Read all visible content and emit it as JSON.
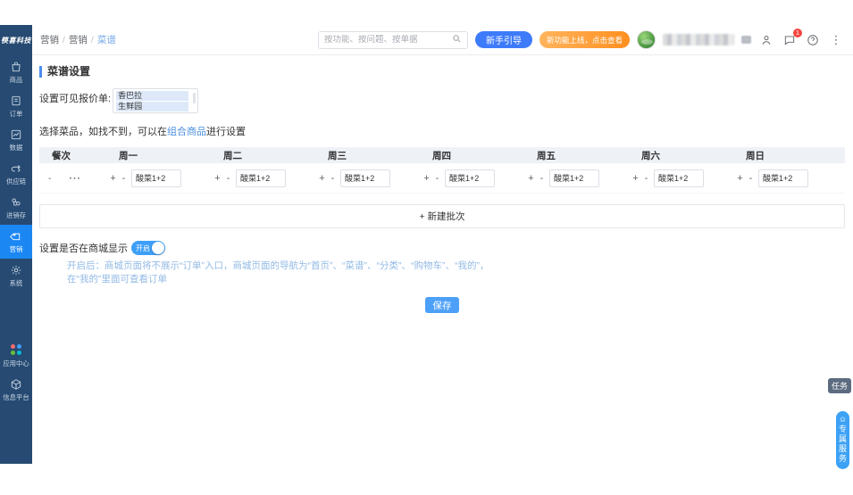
{
  "brand": {
    "name": "筷喜科技"
  },
  "sidebar": {
    "items": [
      {
        "label": "商品",
        "icon": "bag-icon"
      },
      {
        "label": "订单",
        "icon": "order-icon"
      },
      {
        "label": "数据",
        "icon": "chart-icon"
      },
      {
        "label": "供应链",
        "icon": "supply-chain-icon"
      },
      {
        "label": "进销存",
        "icon": "inventory-icon"
      },
      {
        "label": "营销",
        "icon": "marketing-tag-icon",
        "active": true
      },
      {
        "label": "系统",
        "icon": "gear-icon"
      },
      {
        "label": "应用中心",
        "icon": "app-center-icon"
      },
      {
        "label": "信息平台",
        "icon": "platform-cube-icon"
      }
    ]
  },
  "header": {
    "breadcrumb": [
      "营销",
      "营销",
      "菜谱"
    ],
    "separator": "/",
    "search_placeholder": "按功能、按问题、按单据",
    "guide_button": "新手引导",
    "promo_button": "新功能上线，点击查看",
    "chat_badge": "1",
    "more_glyph": "⋮"
  },
  "page": {
    "title": "菜谱设置",
    "quote_label": "设置可见报价单:",
    "quote_options": [
      "香巴拉",
      "生鲜园"
    ],
    "tip_prefix": "选择菜品，如找不到，可以在",
    "tip_link": "组合商品",
    "tip_suffix": "进行设置"
  },
  "schedule": {
    "columns": [
      "餐次",
      "周一",
      "周二",
      "周三",
      "周四",
      "周五",
      "周六",
      "周日"
    ],
    "row": {
      "mealtime": "-",
      "more": "···",
      "plus": "+",
      "minus": "-",
      "dish_value": "酸菜1+2"
    }
  },
  "actions": {
    "new_batch": "+ 新建批次",
    "save": "保存"
  },
  "mall": {
    "label": "设置是否在商城显示",
    "toggle_text": "开启",
    "hint_line1": "开启后：商城页面将不展示“订单”入口，商城页面的导航为“首页”、“菜谱”、“分类”、“购物车”、“我的”，",
    "hint_line2": "在“我的”里面可查看订单"
  },
  "floating": {
    "task": "任务",
    "service": "专属服务",
    "service_icon_glyph": "☺"
  },
  "colors": {
    "sidebar_bg": "#264a72",
    "active_item": "#1b87f3",
    "guide_blue": "#3e7bfa",
    "promo_orange": "#ff8f1f",
    "save_blue": "#4da0f7",
    "toggle_blue": "#3d9ff7",
    "link_blue": "#4c8fe0",
    "badge_red": "#f4453e"
  }
}
